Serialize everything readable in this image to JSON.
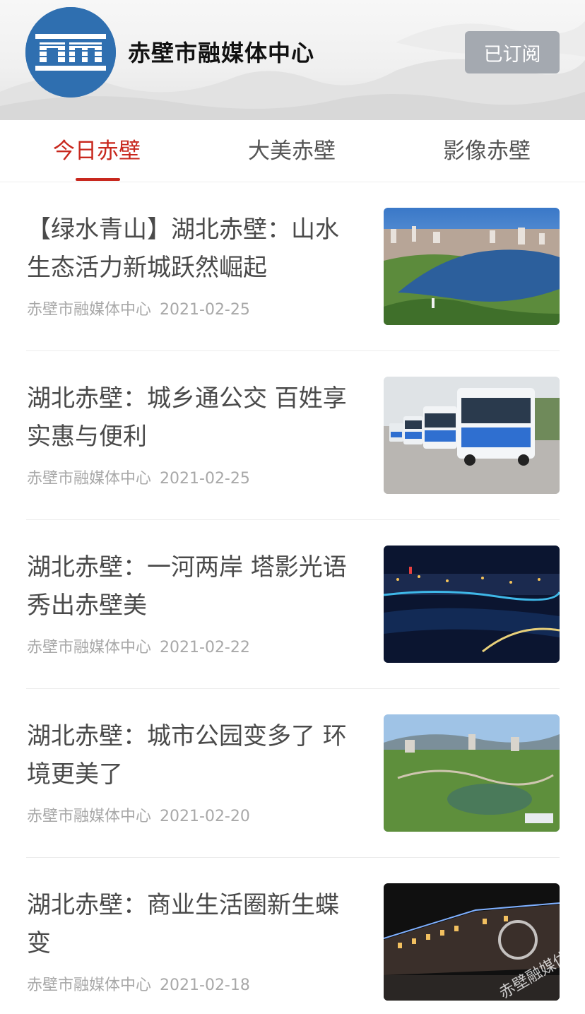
{
  "header": {
    "logo_text": "RM",
    "channel_name": "赤壁市融媒体中心",
    "subscribe_label": "已订阅"
  },
  "tabs": [
    {
      "label": "今日赤壁",
      "active": true
    },
    {
      "label": "大美赤壁",
      "active": false
    },
    {
      "label": "影像赤壁",
      "active": false
    }
  ],
  "colors": {
    "accent": "#c8281e",
    "logo_blue": "#2f6fb0",
    "subscribe_bg": "#a4a9b0"
  },
  "articles": [
    {
      "title": "【绿水青山】湖北赤壁：山水生态活力新城跃然崛起",
      "source": "赤壁市融媒体中心",
      "date": "2021-02-25",
      "thumb": "river-city-photo"
    },
    {
      "title": "湖北赤壁：城乡通公交 百姓享实惠与便利",
      "source": "赤壁市融媒体中心",
      "date": "2021-02-25",
      "thumb": "bus-fleet-photo"
    },
    {
      "title": "湖北赤壁：一河两岸 塔影光语 秀出赤壁美",
      "source": "赤壁市融媒体中心",
      "date": "2021-02-22",
      "thumb": "night-river-photo"
    },
    {
      "title": "湖北赤壁：城市公园变多了 环境更美了",
      "source": "赤壁市融媒体中心",
      "date": "2021-02-20",
      "thumb": "city-park-photo"
    },
    {
      "title": "湖北赤壁：商业生活圈新生蝶变",
      "source": "赤壁市融媒体中心",
      "date": "2021-02-18",
      "thumb": "night-street-photo"
    }
  ],
  "watermark_text": "赤壁融媒体"
}
